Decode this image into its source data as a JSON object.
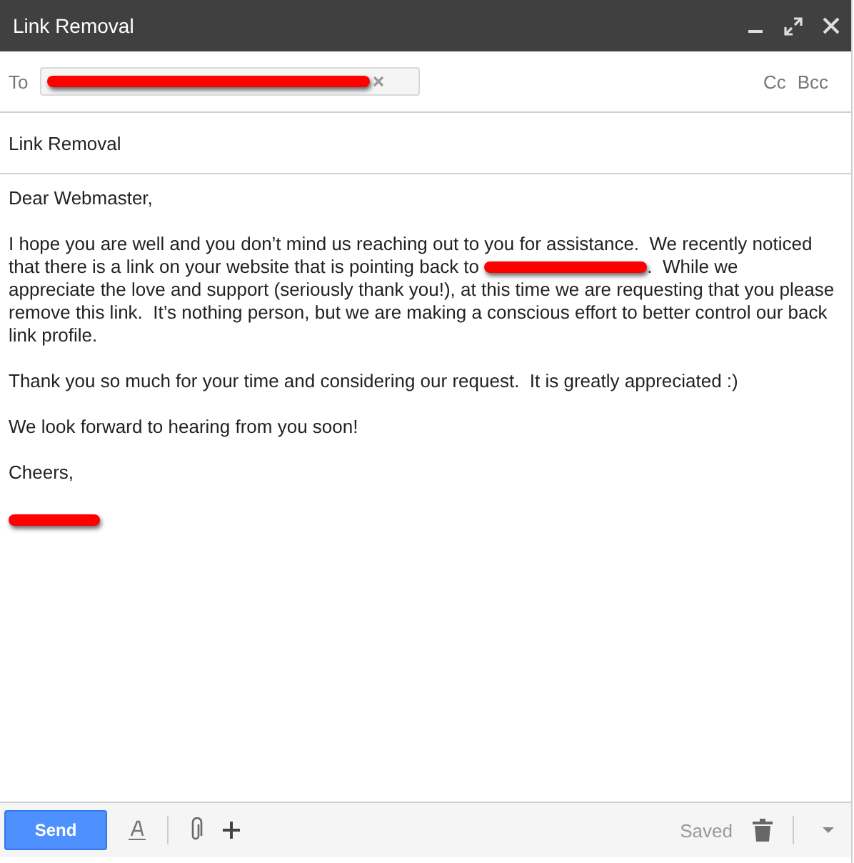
{
  "window": {
    "title": "Link Removal"
  },
  "to": {
    "label": "To",
    "recipient_redacted": true,
    "cc": "Cc",
    "bcc": "Bcc"
  },
  "subject": "Link Removal",
  "body": [
    {
      "kind": "text",
      "text": "Dear Webmaster,"
    },
    {
      "kind": "redacted",
      "lines_before": [
        "I hope you are well and you don’t mind us reaching out to you for assistance.  We recently noticed"
      ],
      "before": "that there is a link on your website that is pointing back to ",
      "after": ".  While we",
      "lines_after": [
        "appreciate the love and support (seriously thank you!), at this time we are requesting that you please",
        "remove this link.  It’s nothing person, but we are making a conscious effort to better control our back",
        "link profile."
      ]
    },
    {
      "kind": "text",
      "text": "Thank you so much for your time and considering our request.  It is greatly appreciated :)"
    },
    {
      "kind": "text",
      "text": "We look forward to hearing from you soon!"
    },
    {
      "kind": "text",
      "text": "Cheers,"
    },
    {
      "kind": "signature"
    }
  ],
  "footer": {
    "send": "Send",
    "status": "Saved"
  }
}
